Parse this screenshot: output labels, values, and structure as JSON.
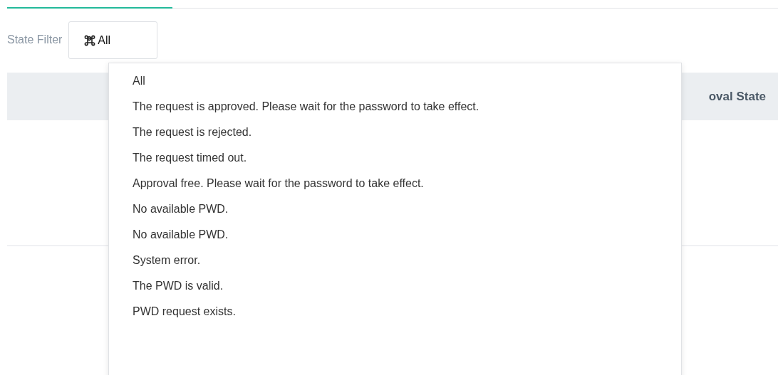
{
  "filter": {
    "label": "State Filter",
    "value": "All"
  },
  "table": {
    "columns": [
      "oval State"
    ]
  },
  "dropdown": {
    "options": [
      "All",
      "The request is approved. Please wait for the password to take effect.",
      "The request is rejected.",
      "The request timed out.",
      "Approval free. Please wait for the password to take effect.",
      "No available PWD.",
      "No available PWD.",
      "System error.",
      "The PWD is valid.",
      "PWD request exists."
    ]
  }
}
